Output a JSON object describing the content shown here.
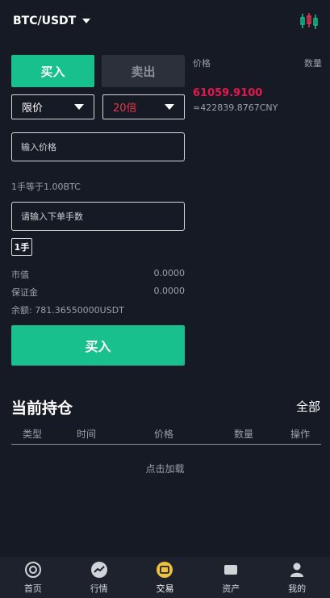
{
  "header": {
    "pair": "BTC/USDT"
  },
  "order_form": {
    "buy_tab": "买入",
    "sell_tab": "卖出",
    "order_type": "限价",
    "leverage": "20倍",
    "price_placeholder": "输入价格",
    "lot_note": "1手等于1.00BTC",
    "qty_placeholder": "请输入下单手数",
    "lot_button": "1手",
    "market_value_label": "市值",
    "market_value": "0.0000",
    "margin_label": "保证金",
    "margin_value": "0.0000",
    "balance_label": "余额: 781.36550000USDT",
    "submit_label": "买入"
  },
  "order_book": {
    "price_header": "价格",
    "qty_header": "数量",
    "last_price": "61059.9100",
    "cny_price": "≈422839.8767CNY"
  },
  "positions": {
    "title": "当前持仓",
    "all_link": "全部",
    "columns": [
      "类型",
      "时间",
      "价格",
      "数量",
      "操作"
    ],
    "load_more": "点击加载"
  },
  "tabbar": {
    "items": [
      {
        "label": "首页",
        "icon": "home-icon"
      },
      {
        "label": "行情",
        "icon": "market-icon"
      },
      {
        "label": "交易",
        "icon": "trade-icon"
      },
      {
        "label": "资产",
        "icon": "assets-icon"
      },
      {
        "label": "我的",
        "icon": "user-icon"
      }
    ]
  },
  "colors": {
    "background": "#151a24",
    "buy_green": "#17c08c",
    "sell_gray": "#2b303b",
    "price_red": "#e8164f",
    "leverage_red": "#e8374c",
    "muted_text": "#9aa0aa"
  }
}
